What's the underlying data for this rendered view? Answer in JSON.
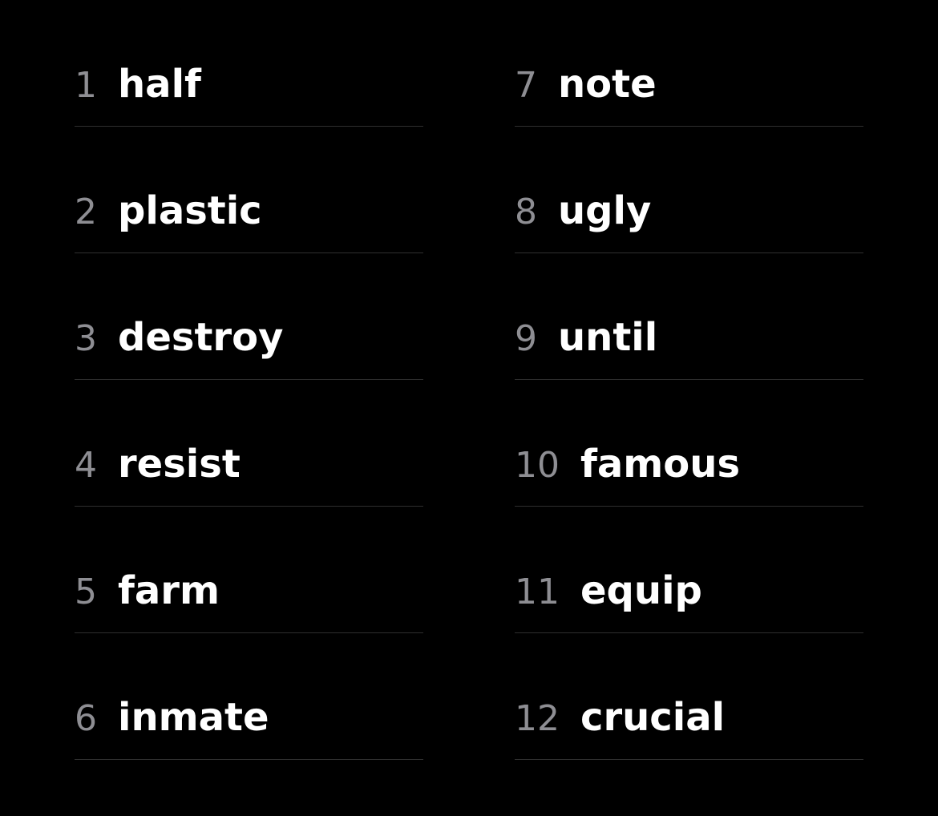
{
  "seed_phrase": {
    "left_column": [
      {
        "number": "1",
        "word": "half"
      },
      {
        "number": "2",
        "word": "plastic"
      },
      {
        "number": "3",
        "word": "destroy"
      },
      {
        "number": "4",
        "word": "resist"
      },
      {
        "number": "5",
        "word": "farm"
      },
      {
        "number": "6",
        "word": "inmate"
      }
    ],
    "right_column": [
      {
        "number": "7",
        "word": "note"
      },
      {
        "number": "8",
        "word": "ugly"
      },
      {
        "number": "9",
        "word": "until"
      },
      {
        "number": "10",
        "word": "famous"
      },
      {
        "number": "11",
        "word": "equip"
      },
      {
        "number": "12",
        "word": "crucial"
      }
    ]
  },
  "colors": {
    "background": "#000000",
    "number": "#8e8e93",
    "word": "#ffffff",
    "divider": "#2f2f2f"
  }
}
